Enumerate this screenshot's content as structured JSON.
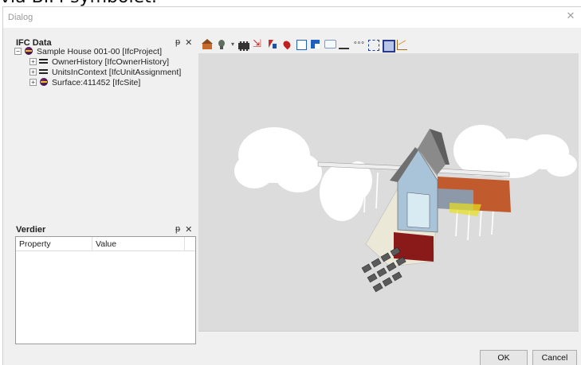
{
  "caption": "via BIM-symbolet:",
  "window": {
    "title": "Dialog",
    "close_glyph": "✕"
  },
  "ifc_pane": {
    "title": "IFC Data",
    "pin_glyph": "ᵽ",
    "close_glyph": "✕",
    "tree": [
      {
        "label": "Sample House 001-00 [IfcProject]",
        "icon": "project-globe-icon",
        "expander": "−",
        "level": 1
      },
      {
        "label": "OwnerHistory [IfcOwnerHistory]",
        "icon": "attribute-lines-icon",
        "expander": "+",
        "level": 2
      },
      {
        "label": "UnitsInContext [IfcUnitAssignment]",
        "icon": "attribute-lines-icon",
        "expander": "+",
        "level": 2
      },
      {
        "label": "Surface:411452 [IfcSite]",
        "icon": "site-globe-icon",
        "expander": "+",
        "level": 2
      }
    ]
  },
  "props_pane": {
    "title": "Verdier",
    "pin_glyph": "ᵽ",
    "close_glyph": "✕",
    "columns": [
      "Property",
      "Value"
    ]
  },
  "toolbar": {
    "buttons": [
      "home-view-icon",
      "light-bulb-icon",
      "dropdown-arrow",
      "film-strip-icon",
      "section-arrows-icon",
      "select-cursor-icon",
      "color-drop-icon",
      "outline-box-icon",
      "flag-box-icon",
      "comment-icon",
      "underline-tool-icon",
      "dots-icon",
      "dashed-frame-icon",
      "solid-frame-icon",
      "chart-icon"
    ],
    "dropdown_glyph": "▾"
  },
  "viewport": {
    "background": "#dcdcdc",
    "model": "3d-house-model"
  },
  "footer": {
    "ok_label": "OK",
    "cancel_label": "Cancel"
  }
}
